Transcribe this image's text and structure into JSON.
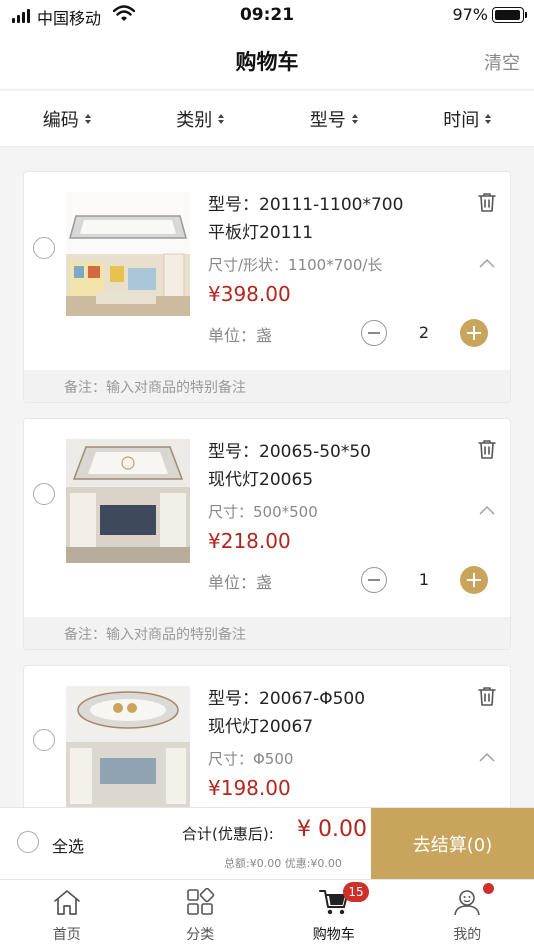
{
  "status_bar": {
    "carrier": "中国移动",
    "time": "09:21",
    "battery": "97%"
  },
  "nav": {
    "title": "购物车",
    "clear": "清空"
  },
  "sort": [
    {
      "label": "编码"
    },
    {
      "label": "类别"
    },
    {
      "label": "型号"
    },
    {
      "label": "时间"
    }
  ],
  "items": [
    {
      "model": "型号：20111-1100*700",
      "name": "平板灯20111",
      "size": "尺寸/形状：1100*700/长",
      "price": "¥398.00",
      "unit": "单位：盏",
      "qty": "2",
      "note_placeholder": "备注：输入对商品的特别备注",
      "thumb_icon": "rectangular-ceiling-lamp-photo"
    },
    {
      "model": "型号：20065-50*50",
      "name": "现代灯20065",
      "size": "尺寸：500*500",
      "price": "¥218.00",
      "unit": "单位：盏",
      "qty": "1",
      "note_placeholder": "备注：输入对商品的特别备注",
      "thumb_icon": "square-ceiling-lamp-photo"
    },
    {
      "model": "型号：20067-Φ500",
      "name": "现代灯20067",
      "size": "尺寸：Φ500",
      "price": "¥198.00",
      "thumb_icon": "round-ceiling-lamp-photo"
    }
  ],
  "checkout": {
    "select_all": "全选",
    "total_label": "合计(优惠后):",
    "total_value": "¥ 0.00",
    "detail": "总额:¥0.00 优惠:¥0.00",
    "button": "去结算(0)"
  },
  "tabs": [
    {
      "label": "首页",
      "icon": "home-icon"
    },
    {
      "label": "分类",
      "icon": "category-icon"
    },
    {
      "label": "购物车",
      "icon": "cart-icon",
      "badge": "15"
    },
    {
      "label": "我的",
      "icon": "profile-icon"
    }
  ],
  "colors": {
    "accent": "#c9a45c",
    "price": "#b3261e",
    "badge": "#d0302a"
  }
}
